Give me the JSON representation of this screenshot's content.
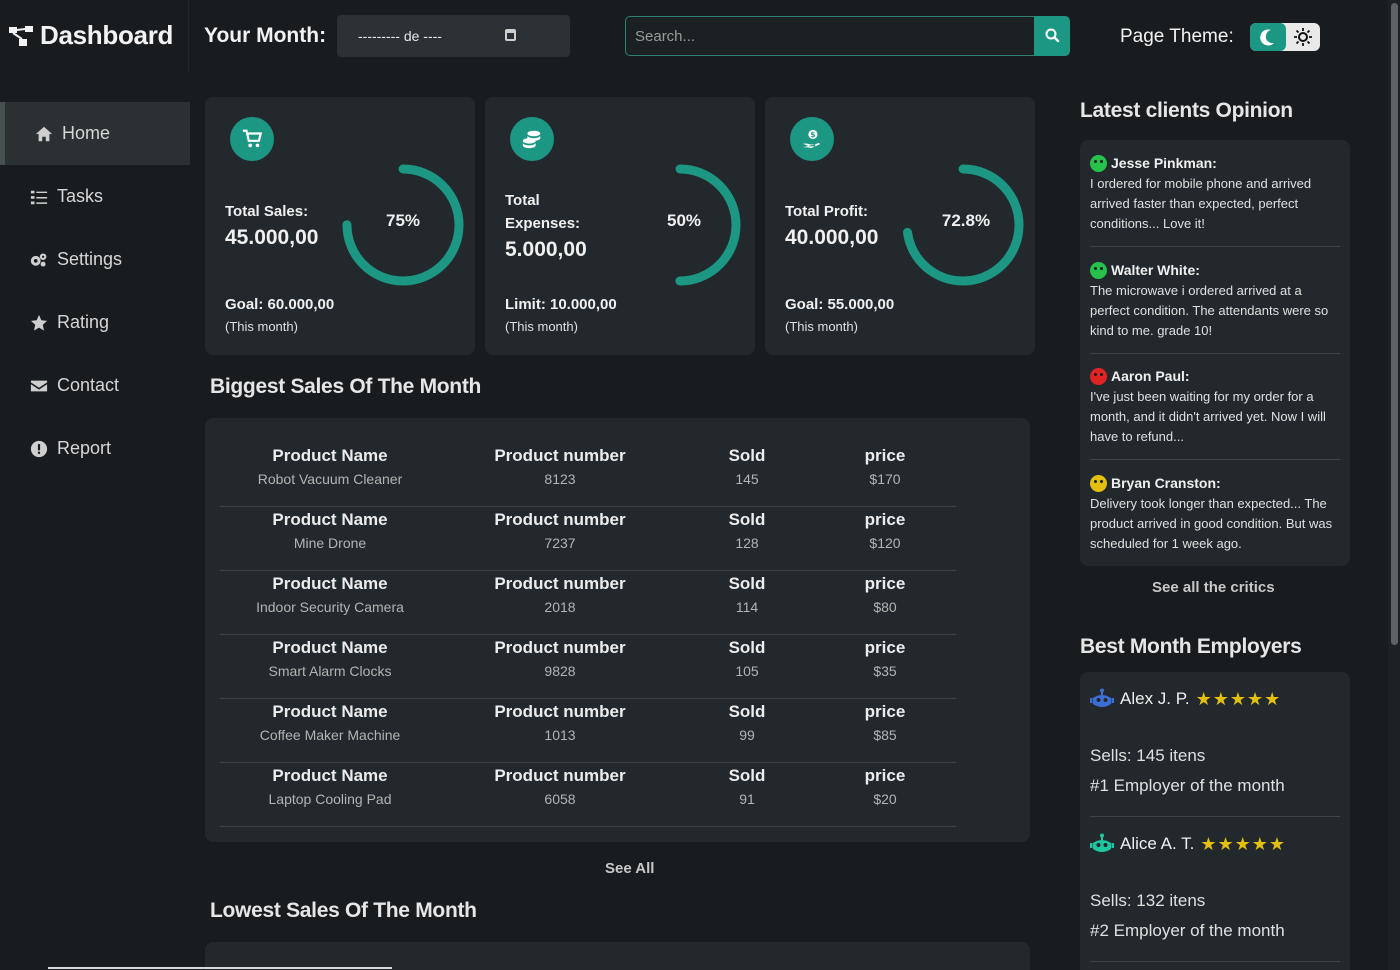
{
  "header": {
    "app_title": "Dashboard",
    "month_label": "Your Month:",
    "month_value": "--------- de ----",
    "search_placeholder": "Search...",
    "theme_label": "Page Theme:"
  },
  "sidebar": {
    "items": [
      {
        "label": "Home",
        "icon": "home-icon",
        "active": true
      },
      {
        "label": "Tasks",
        "icon": "tasks-icon"
      },
      {
        "label": "Settings",
        "icon": "gears-icon"
      },
      {
        "label": "Rating",
        "icon": "star-icon"
      },
      {
        "label": "Contact",
        "icon": "envelope-icon"
      },
      {
        "label": "Report",
        "icon": "alert-icon"
      }
    ]
  },
  "cards": [
    {
      "icon": "cart-icon",
      "title": "Total Sales:",
      "value": "45.000,00",
      "percent_label": "75%",
      "percent": 0.75,
      "goal": "Goal: 60.000,00",
      "note": "(This month)"
    },
    {
      "icon": "coins-icon",
      "title": "Total Expenses:",
      "value": "5.000,00",
      "percent_label": "50%",
      "percent": 0.5,
      "goal": "Limit: 10.000,00",
      "note": "(This month)"
    },
    {
      "icon": "profit-hand-icon",
      "title": "Total Profit:",
      "value": "40.000,00",
      "percent_label": "72.8%",
      "percent": 0.728,
      "goal": "Goal: 55.000,00",
      "note": "(This month)"
    }
  ],
  "biggest_sales": {
    "title": "Biggest Sales Of The Month",
    "headers": [
      "Product Name",
      "Product number",
      "Sold",
      "price"
    ],
    "rows": [
      [
        "Robot Vacuum Cleaner",
        "8123",
        "145",
        "$170"
      ],
      [
        "Mine Drone",
        "7237",
        "128",
        "$120"
      ],
      [
        "Indoor Security Camera",
        "2018",
        "114",
        "$80"
      ],
      [
        "Smart Alarm Clocks",
        "9828",
        "105",
        "$35"
      ],
      [
        "Coffee Maker Machine",
        "1013",
        "99",
        "$85"
      ],
      [
        "Laptop Cooling Pad",
        "6058",
        "91",
        "$20"
      ]
    ],
    "see_all": "See All"
  },
  "lowest_sales": {
    "title": "Lowest Sales Of The Month"
  },
  "opinions": {
    "title": "Latest clients Opinion",
    "items": [
      {
        "name": "Jesse Pinkman:",
        "mood": "happy",
        "text": "I ordered for mobile phone and arrived arrived faster than expected, perfect conditions... Love it!"
      },
      {
        "name": "Walter White:",
        "mood": "happy",
        "text": "The microwave i ordered arrived at a perfect condition. The attendants were so kind to me. grade 10!"
      },
      {
        "name": "Aaron Paul:",
        "mood": "sad",
        "text": "I've just been waiting for my order for a month, and it didn't arrived yet. Now I will have to refund..."
      },
      {
        "name": "Bryan Cranston:",
        "mood": "neutral",
        "text": "Delivery took longer than expected... The product arrived in good condition. But was scheduled for 1 week ago."
      }
    ],
    "see_all": "See all the critics"
  },
  "employers": {
    "title": "Best Month Employers",
    "items": [
      {
        "name": "Alex J. P.",
        "stars": "★★★★★",
        "icon_color": "#3b6fd8",
        "sells": "Sells: 145 itens",
        "rank": "#1 Employer of the month"
      },
      {
        "name": "Alice A. T.",
        "stars": "★★★★★",
        "icon_color": "#1fc7a0",
        "sells": "Sells: 132 itens",
        "rank": "#2 Employer of the month"
      }
    ]
  },
  "colors": {
    "accent": "#1c9784",
    "card_bg": "#22282b",
    "page_bg": "#181c1f",
    "star": "#e3c00f"
  }
}
